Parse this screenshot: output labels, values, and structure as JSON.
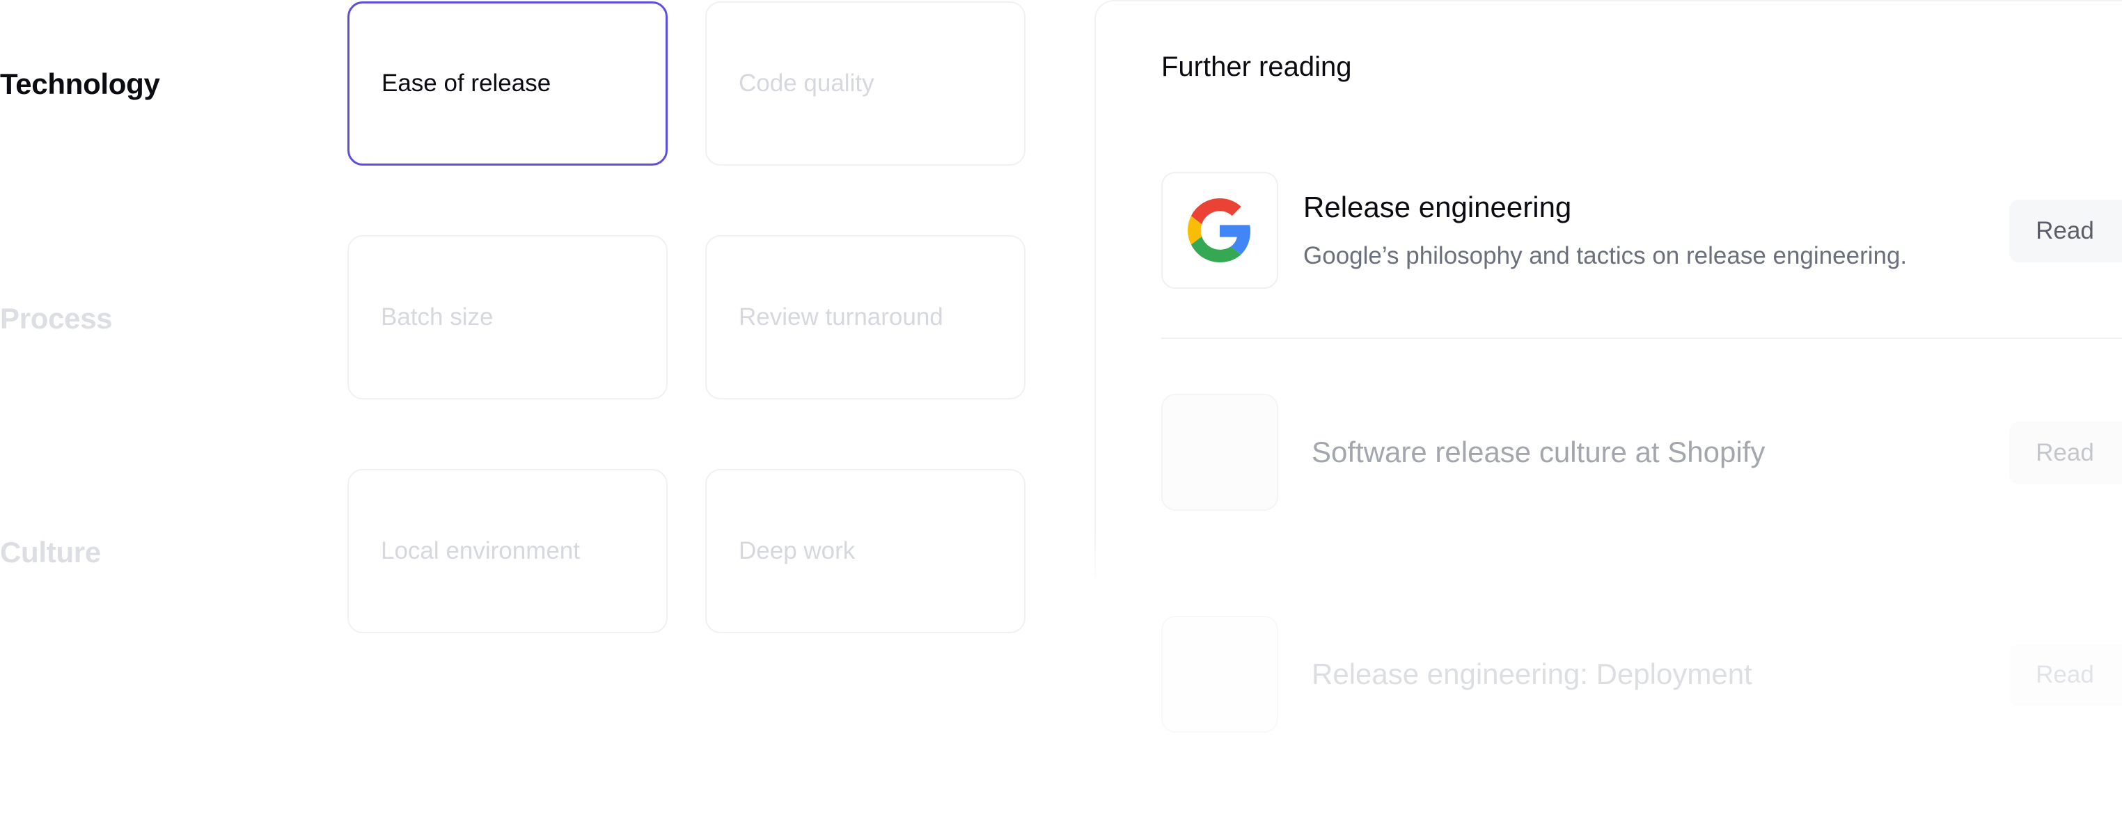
{
  "categories": [
    {
      "label": "Technology",
      "active": true
    },
    {
      "label": "Process",
      "active": false
    },
    {
      "label": "Culture",
      "active": false
    }
  ],
  "metrics": {
    "technology": [
      "Ease of release",
      "Code quality"
    ],
    "process": [
      "Batch size",
      "Review turnaround"
    ],
    "culture": [
      "Local environment",
      "Deep work"
    ]
  },
  "selected_metric": "Ease of release",
  "further_reading": {
    "title": "Further reading",
    "articles": [
      {
        "title": "Release engineering",
        "description": "Google’s philosophy and tactics on release engineering.",
        "icon": "google-logo-icon",
        "button_label": "Read"
      },
      {
        "title": "Software release culture at Shopify",
        "icon": "placeholder-logo-icon",
        "button_label": "Read"
      },
      {
        "title": "Release engineering: Deployment",
        "icon": "placeholder-logo-icon",
        "button_label": "Read"
      }
    ]
  },
  "colors": {
    "accent": "#5b4ee0",
    "text_primary": "#0b0b12",
    "text_muted": "#6b6f7b",
    "text_faded": "#d6d8de",
    "google_red": "#EA4335",
    "google_yellow": "#FBBC05",
    "google_green": "#34A853",
    "google_blue": "#4285F4"
  }
}
